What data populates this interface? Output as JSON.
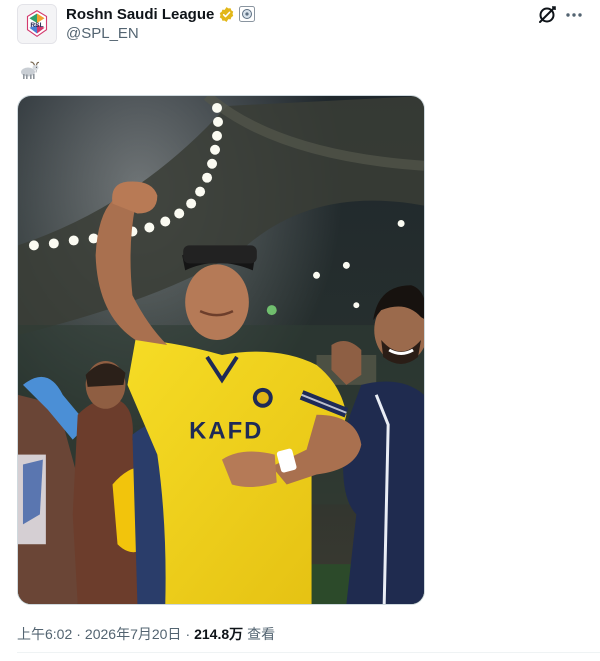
{
  "author": {
    "display_name": "Roshn Saudi League",
    "handle": "@SPL_EN",
    "avatar_text": "RSL",
    "verified": true
  },
  "post": {
    "text_emoji": "goat-emoji",
    "image_alt": "Player in yellow Al Nassr jersey raising fist in celebration",
    "jersey_text": "KAFD"
  },
  "meta": {
    "time": "上午6:02",
    "separator": "·",
    "date": "2026年7月20日",
    "views_count": "214.8万",
    "views_label": "查看"
  },
  "colors": {
    "verified": "#e2b719",
    "muted_text": "#536471",
    "jersey": "#f2d31a"
  }
}
